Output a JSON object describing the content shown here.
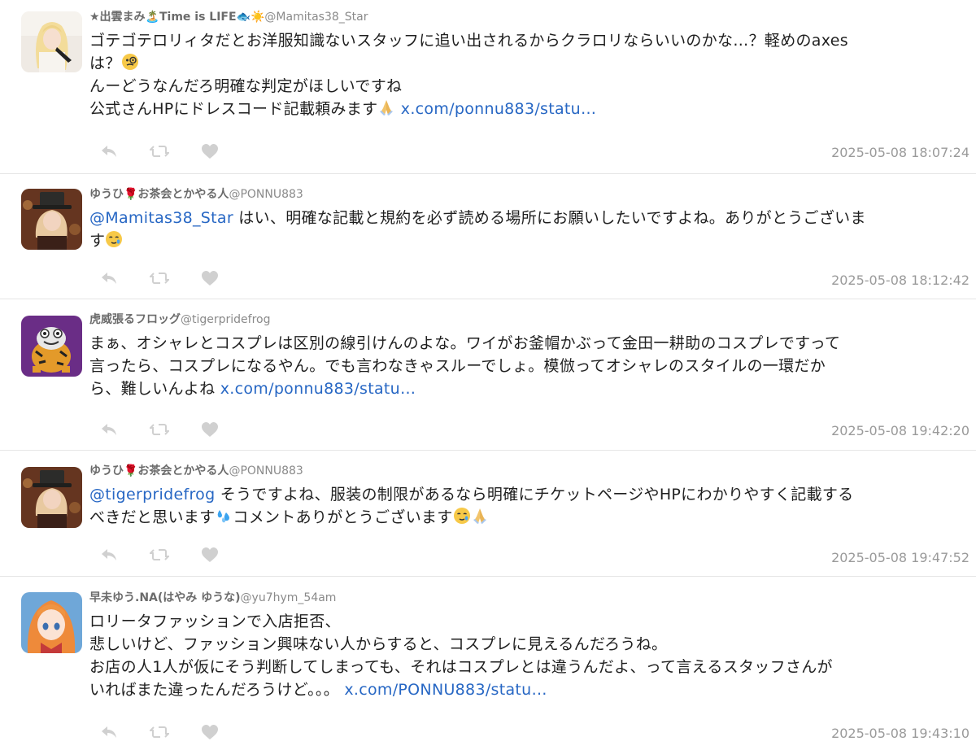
{
  "tweets": [
    {
      "display_name": "★出雲まみ🏝️Time is LIFE🐟☀️",
      "handle": "@Mamitas38_Star",
      "lines": [
        [
          {
            "t": "ゴテゴテロリィタだとお洋服知識ないスタッフに追い出されるからクラロリならいいのかな…？軽めのaxes"
          }
        ],
        [
          {
            "t": "は？"
          },
          {
            "emoji": "monocle-face"
          }
        ],
        [
          {
            "t": "んーどうなんだろ明確な判定がほしいですね"
          }
        ],
        [
          {
            "t": "公式さんHPにドレスコード記載頼みます"
          },
          {
            "emoji": "pray"
          },
          {
            "t": " x.com/ponnu883/statu…",
            "link": true
          }
        ]
      ],
      "timestamp": "2025-05-08 18:07:24",
      "avatar": "blonde-girl"
    },
    {
      "display_name": "ゆうひ🌹お茶会とかやる人",
      "handle": "@PONNU883",
      "lines": [
        [
          {
            "t": "@Mamitas38_Star",
            "link": true
          },
          {
            "t": " はい、明確な記載と規約を必ず読める場所にお願いしたいですよね。ありがとうございま"
          }
        ],
        [
          {
            "t": "す"
          },
          {
            "emoji": "teary-face"
          }
        ]
      ],
      "timestamp": "2025-05-08 18:12:42",
      "avatar": "hat-girl"
    },
    {
      "display_name": "虎威張るフロッグ",
      "handle": "@tigerpridefrog",
      "lines": [
        [
          {
            "t": "まぁ、オシャレとコスプレは区別の線引けんのよな。ワイがお釜帽かぶって金田一耕助のコスプレですって"
          }
        ],
        [
          {
            "t": "言ったら、コスプレになるやん。でも言わなきゃスルーでしょ。模倣ってオシャレのスタイルの一環だか"
          }
        ],
        [
          {
            "t": "ら、難しいんよね "
          },
          {
            "t": "x.com/ponnu883/statu…",
            "link": true
          }
        ]
      ],
      "timestamp": "2025-05-08 19:42:20",
      "avatar": "tiger-frog"
    },
    {
      "display_name": "ゆうひ🌹お茶会とかやる人",
      "handle": "@PONNU883",
      "lines": [
        [
          {
            "t": "@tigerpridefrog",
            "link": true
          },
          {
            "t": " そうですよね、服装の制限があるなら明確にチケットページやHPにわかりやすく記載する"
          }
        ],
        [
          {
            "t": "べきだと思います"
          },
          {
            "emoji": "sweat-drops"
          },
          {
            "t": "コメントありがとうございます"
          },
          {
            "emoji": "teary-face"
          },
          {
            "emoji": "pray"
          }
        ]
      ],
      "timestamp": "2025-05-08 19:47:52",
      "avatar": "hat-girl"
    },
    {
      "display_name": "早未ゆう.NA(はやみ ゆうな)",
      "handle": "@yu7hym_54am",
      "lines": [
        [
          {
            "t": "ロリータファッションで入店拒否、"
          }
        ],
        [
          {
            "t": "悲しいけど、ファッション興味ない人からすると、コスプレに見えるんだろうね。"
          }
        ],
        [
          {
            "t": "お店の人1人が仮にそう判断してしまっても、それはコスプレとは違うんだよ、って言えるスタッフさんが"
          }
        ],
        [
          {
            "t": "いればまた違ったんだろうけど。。。 "
          },
          {
            "t": "x.com/PONNU883/statu…",
            "link": true
          }
        ]
      ],
      "timestamp": "2025-05-08 19:43:10",
      "avatar": "anime-girl"
    }
  ],
  "action_icons": [
    "reply-icon",
    "retweet-icon",
    "like-icon"
  ],
  "colors": {
    "link": "#2767c4",
    "meta": "#9a9a9a",
    "icon": "#d0d0d0",
    "divider": "#e6e6e6"
  }
}
